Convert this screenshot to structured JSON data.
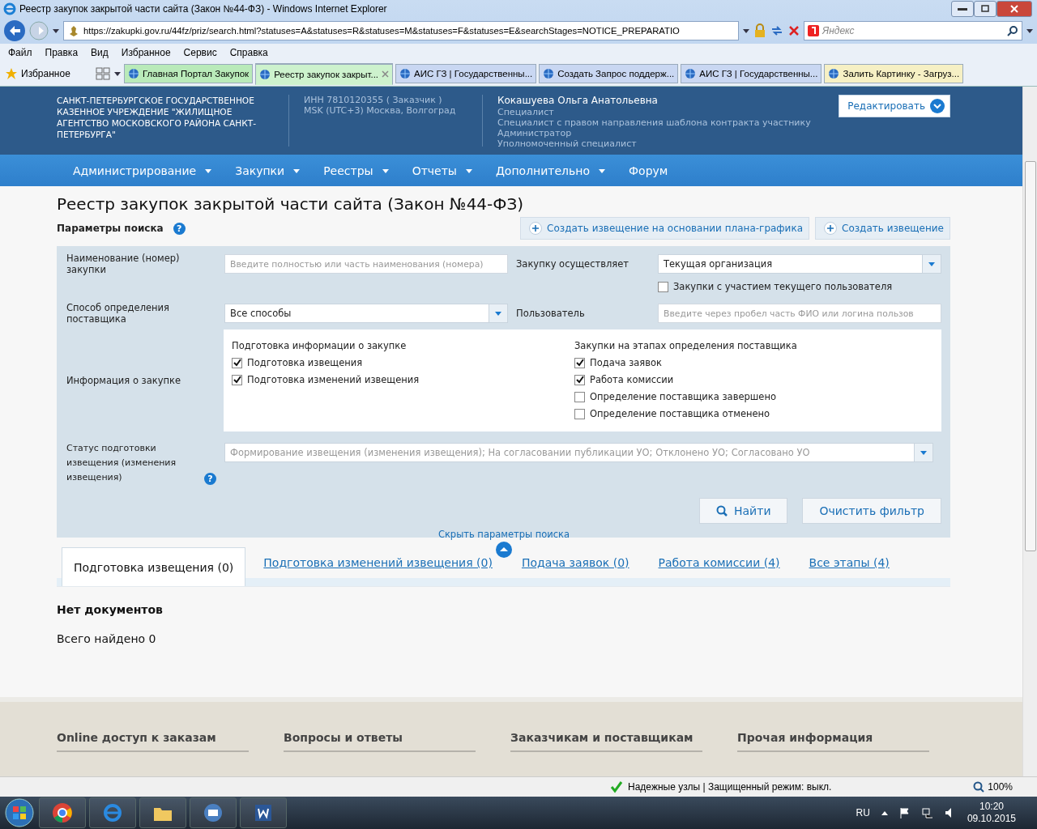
{
  "window": {
    "title": "Реестр закупок закрытой части сайта (Закон №44-ФЗ) - Windows Internet Explorer"
  },
  "address_bar": {
    "url": "https://zakupki.gov.ru/44fz/priz/search.html?statuses=A&statuses=R&statuses=M&statuses=F&statuses=E&searchStages=NOTICE_PREPARATIO",
    "search_placeholder": "Яндекс"
  },
  "menu": [
    "Файл",
    "Правка",
    "Вид",
    "Избранное",
    "Сервис",
    "Справка"
  ],
  "favorites_label": "Избранное",
  "browser_tabs": [
    {
      "label": "Главная Портал Закупок",
      "selected": false,
      "color": "#b9eab9"
    },
    {
      "label": "Реестр закупок закрыт...",
      "selected": true,
      "color": "#cdf2cd"
    },
    {
      "label": "АИС ГЗ | Государственны...",
      "selected": false,
      "color": "#c9d7f2"
    },
    {
      "label": "Создать Запрос поддерж...",
      "selected": false,
      "color": "#c9d7f2"
    },
    {
      "label": "АИС ГЗ | Государственны...",
      "selected": false,
      "color": "#c9d7f2"
    },
    {
      "label": "Залить Картинку - Загруз...",
      "selected": false,
      "color": "#f6f0c4"
    }
  ],
  "header": {
    "org": "САНКТ-ПЕТЕРБУРГСКОЕ ГОСУДАРСТВЕННОЕ КАЗЕННОЕ УЧРЕЖДЕНИЕ \"ЖИЛИЩНОЕ АГЕНТСТВО МОСКОВСКОГО РАЙОНА САНКТ-ПЕТЕРБУРГА\"",
    "inn": "ИНН 7810120355 ( Заказчик )",
    "timezone": "MSK (UTC+3) Москва, Волгоград",
    "user": "Кокашуева Ольга Анатольевна",
    "roles": [
      "Специалист",
      "Специалист с правом направления шаблона контракта участнику",
      "Администратор",
      "Уполномоченный специалист"
    ],
    "edit_button": "Редактировать"
  },
  "nav": [
    {
      "label": "Администрирование",
      "dropdown": true
    },
    {
      "label": "Закупки",
      "dropdown": true
    },
    {
      "label": "Реестры",
      "dropdown": true
    },
    {
      "label": "Отчеты",
      "dropdown": true
    },
    {
      "label": "Дополнительно",
      "dropdown": true
    },
    {
      "label": "Форум",
      "dropdown": false
    }
  ],
  "page_title": "Реестр закупок закрытой части сайта (Закон №44-ФЗ)",
  "search_params_label": "Параметры поиска",
  "search_params_help": "?",
  "action_buttons": [
    "Создать извещение на основании плана-графика",
    "Создать извещение"
  ],
  "form": {
    "name_label": "Наименование (номер) закупки",
    "name_placeholder": "Введите полностью или часть наименования (номера)",
    "performer_label": "Закупку осуществляет",
    "performer_value": "Текущая организация",
    "participation": {
      "label": "Закупки с участием текущего пользователя",
      "checked": false
    },
    "method_label": "Способ определения поставщика",
    "method_value": "Все способы",
    "user_label": "Пользователь",
    "user_placeholder": "Введите через пробел часть ФИО или логина пользов",
    "info_label": "Информация о закупке",
    "info_groups": [
      {
        "title": "Подготовка информации о закупке",
        "options": [
          {
            "label": "Подготовка извещения",
            "checked": true
          },
          {
            "label": "Подготовка изменений извещения",
            "checked": true
          }
        ]
      },
      {
        "title": "Закупки на этапах определения поставщика",
        "options": [
          {
            "label": "Подача заявок",
            "checked": true
          },
          {
            "label": "Работа комиссии",
            "checked": true
          },
          {
            "label": "Определение поставщика завершено",
            "checked": false
          },
          {
            "label": "Определение поставщика отменено",
            "checked": false
          }
        ]
      }
    ],
    "status_label": "Статус подготовки извещения (изменения извещения)",
    "status_help": "?",
    "status_value": "Формирование извещения (изменения извещения); На согласовании публикации УО; Отклонено УО; Согласовано УО",
    "find_button": "Найти",
    "clear_button": "Очистить фильтр",
    "hide_link": "Скрыть параметры поиска"
  },
  "tabs": [
    {
      "label": "Подготовка извещения (0)",
      "selected": true
    },
    {
      "label": "Подготовка изменений извещения (0)",
      "selected": false
    },
    {
      "label": "Подача заявок (0)",
      "selected": false
    },
    {
      "label": "Работа комиссии (4)",
      "selected": false
    },
    {
      "label": "Все этапы (4)",
      "selected": false
    }
  ],
  "no_documents": "Нет документов",
  "total_found": "Всего найдено 0",
  "footer": [
    "Online доступ к заказам",
    "Вопросы и ответы",
    "Заказчикам и поставщикам",
    "Прочая информация"
  ],
  "status_bar": {
    "text": "Надежные узлы | Защищенный режим: выкл.",
    "zoom": "100%"
  },
  "taskbar": {
    "language": "RU",
    "time": "10:20",
    "date": "09.10.2015"
  }
}
